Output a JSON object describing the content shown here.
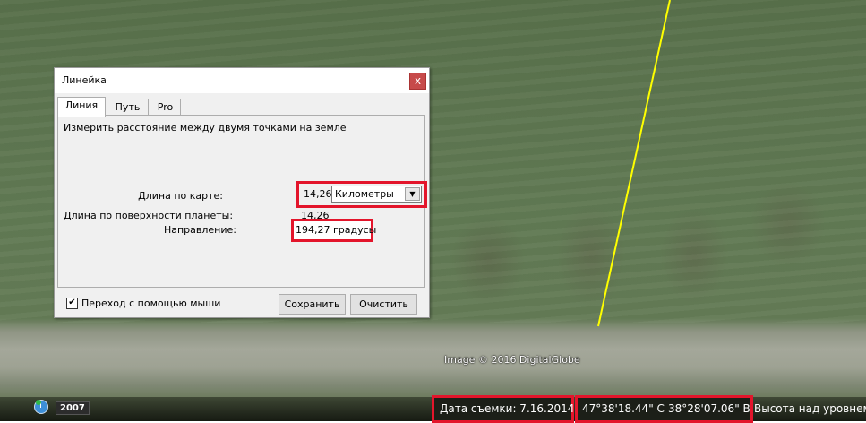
{
  "map": {
    "imagery_credit": "Image © 2016 DigitalGlobe",
    "ruler_color": "#ffff00"
  },
  "dialog": {
    "title": "Линейка",
    "close_icon": "close-icon",
    "close_glyph": "x",
    "tabs": [
      {
        "label": "Линия",
        "active": true
      },
      {
        "label": "Путь",
        "active": false
      },
      {
        "label": "Pro",
        "active": false
      }
    ],
    "description": "Измерить расстояние между двумя точками на земле",
    "map_length_label": "Длина по карте:",
    "map_length_value": "14,26",
    "units_selected": "Километры",
    "surface_length_label": "Длина по поверхности планеты:",
    "surface_length_value": "14,26",
    "direction_label": "Направление:",
    "direction_value": "194,27 градусы",
    "mouse_nav_label": "Переход с помощью мыши",
    "mouse_nav_checked": true,
    "save_label": "Сохранить",
    "clear_label": "Очистить"
  },
  "statusbar": {
    "history_icon": "clock-icon",
    "year": "2007",
    "capture_date": "Дата съемки: 7.16.2014",
    "latitude": "47°38'18.44\" С",
    "longitude": "38°28'07.06\" В",
    "elevation_label": "Высота над уровнем м"
  },
  "colors": {
    "highlight_red": "#e3152b",
    "ruler_yellow": "#ffff00"
  }
}
